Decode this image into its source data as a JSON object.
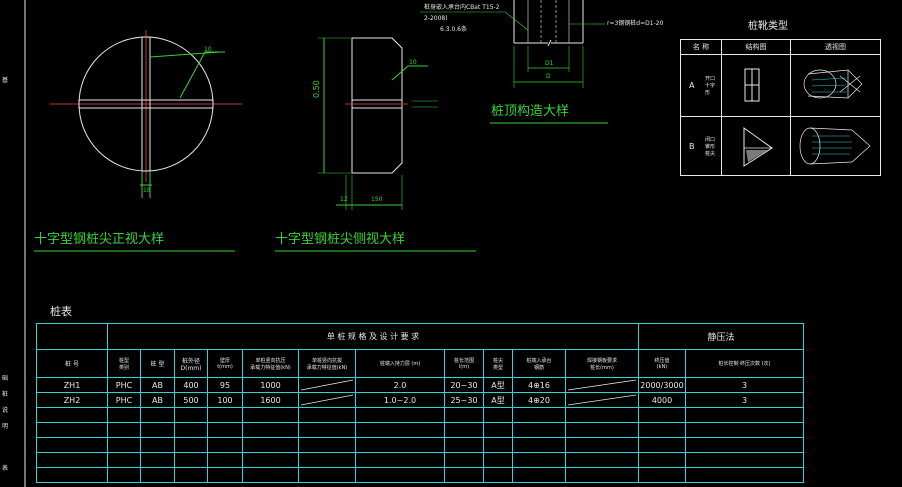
{
  "captions": {
    "front_view": "十字型钢桩尖正视大样",
    "side_view": "十字型钢桩尖侧视大样",
    "pile_top": "桩顶构造大样",
    "pile_table": "桩表"
  },
  "dims": {
    "front_weld": "10",
    "front_bottom": "18",
    "side_height": "0.50",
    "side_weld": "10",
    "side_bottom_a": "12",
    "side_bottom_b": "150",
    "top_d1": "D1",
    "top_d": "D"
  },
  "notes": {
    "line1": "桩身嵌入承台内CBat T15-2",
    "line2": "2-2008)",
    "line3": "6.3.0.6条",
    "right": "r=3钢钢桩d=D1-20"
  },
  "pile_type": {
    "title": "桩靴类型",
    "headers": [
      "名 称",
      "结构图",
      "透视图"
    ],
    "rows": [
      {
        "name": "A",
        "desc": "开口\n十字\n形"
      },
      {
        "name": "B",
        "desc": "闭口\n锥形\n桩尖"
      }
    ]
  },
  "pile_table": {
    "group_design": "单 桩 规 格 及 设 计 要 求",
    "group_press": "静压法",
    "headers": [
      "桩 号",
      "桩型\n类别",
      "桩 型",
      "桩外径\nD(mm)",
      "壁厚\nt(mm)",
      "单桩竖向抗压\n承载力特征值(kN)",
      "单桩竖向抗拔\n承载力特征值(kN)",
      "桩端入持力层 (m)",
      "桩长范围\nl(m)",
      "桩尖\n类型",
      "桩端入承台\n钢筋",
      "焊接钢板要求\n桩长(mm)",
      "终压值\n(kN)",
      "桩长控制 终压次数 (次)"
    ],
    "rows": [
      [
        "ZH1",
        "PHC",
        "AB",
        "400",
        "95",
        "1000",
        "",
        "2.0",
        "20~30",
        "A型",
        "4⊕16",
        "",
        "2000/3000",
        "3"
      ],
      [
        "ZH2",
        "PHC",
        "AB",
        "500",
        "100",
        "1600",
        "",
        "1.0~2.0",
        "25~30",
        "A型",
        "4⊕20",
        "",
        "4000",
        "3"
      ]
    ]
  },
  "left_margin": [
    "基",
    "础",
    "桩",
    "说",
    "明",
    "表"
  ]
}
